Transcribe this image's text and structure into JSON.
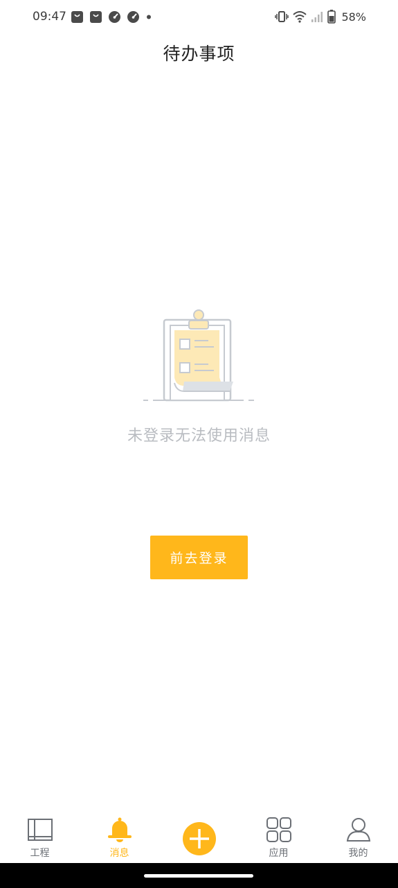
{
  "status_bar": {
    "time": "09:47",
    "notification_icons": [
      "bag-icon",
      "bag-icon",
      "speedometer-icon",
      "speedometer-icon",
      "dot-icon"
    ],
    "right_icons": [
      "vibrate-icon",
      "wifi-icon",
      "cellular-signal-icon",
      "battery-icon"
    ],
    "battery_percent": "58%"
  },
  "header": {
    "title": "待办事项"
  },
  "empty_state": {
    "illustration": "clipboard-checklist-icon",
    "message": "未登录无法使用消息",
    "button_label": "前去登录"
  },
  "tab_bar": {
    "items": [
      {
        "label": "工程",
        "icon": "project-icon",
        "active": false
      },
      {
        "label": "消息",
        "icon": "bell-icon",
        "active": true
      },
      {
        "label": "",
        "icon": "add-circle-icon",
        "active": false
      },
      {
        "label": "应用",
        "icon": "apps-grid-icon",
        "active": false
      },
      {
        "label": "我的",
        "icon": "user-icon",
        "active": false
      }
    ]
  },
  "colors": {
    "accent": "#ffb71b",
    "text_primary": "#222222",
    "text_muted": "#b9bcc1",
    "tab_inactive": "#6b6f75"
  }
}
